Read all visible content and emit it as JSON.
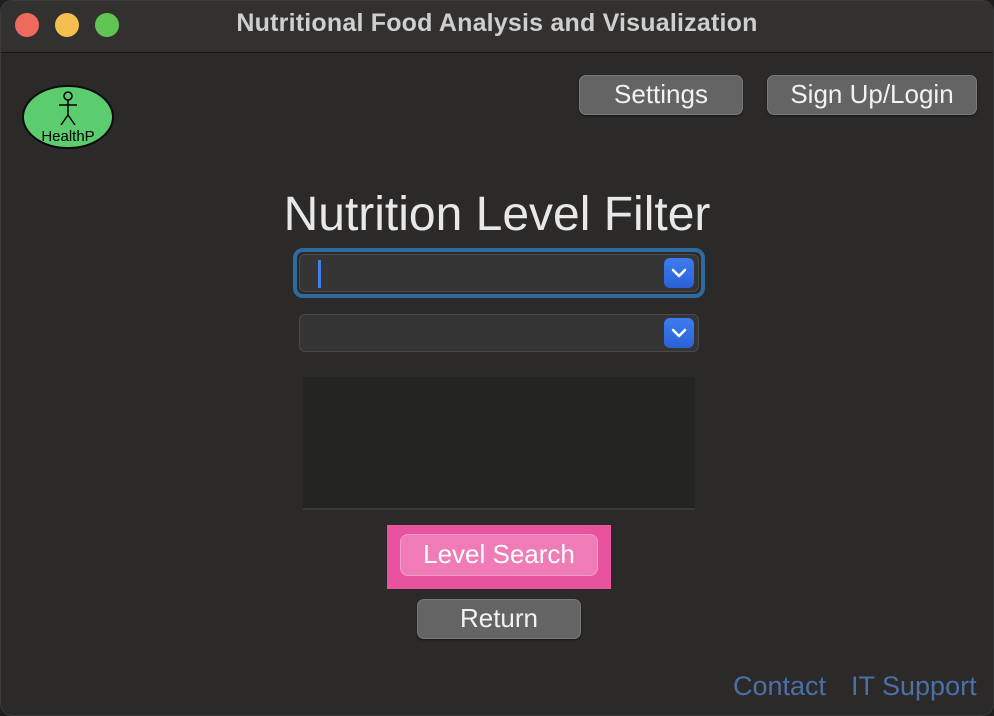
{
  "window": {
    "title": "Nutritional Food Analysis and Visualization"
  },
  "logo": {
    "text": "HealthP",
    "color": "#5ccd6e"
  },
  "header": {
    "settings_label": "Settings",
    "signup_label": "Sign Up/Login"
  },
  "main": {
    "heading": "Nutrition Level Filter",
    "primary_dropdown_value": "",
    "secondary_dropdown_value": "",
    "results_text": "",
    "level_search_label": "Level Search",
    "return_label": "Return"
  },
  "footer": {
    "contact_label": "Contact",
    "support_label": "IT Support"
  },
  "colors": {
    "accent_blue": "#2a62d6",
    "highlight_pink": "#e8529e",
    "link_blue": "#4b6fa6"
  }
}
